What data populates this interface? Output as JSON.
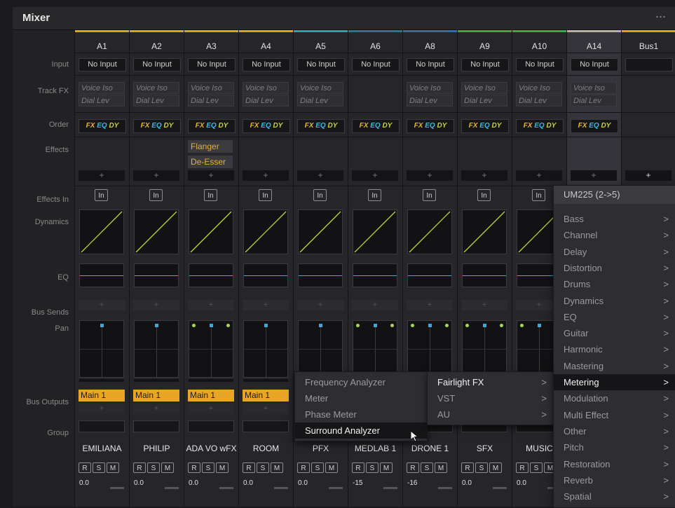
{
  "window": {
    "title": "Mixer"
  },
  "row_labels": {
    "input": "Input",
    "track_fx": "Track FX",
    "order": "Order",
    "effects": "Effects",
    "effects_in": "Effects In",
    "dynamics": "Dynamics",
    "eq": "EQ",
    "bus_sends": "Bus Sends",
    "pan": "Pan",
    "bus_outputs": "Bus Outputs",
    "group": "Group"
  },
  "order_labels": {
    "fx": "FX",
    "eq": "EQ",
    "dy": "DY"
  },
  "common": {
    "plus": "+",
    "in": "In",
    "r": "R",
    "s": "S",
    "m": "M",
    "voice_iso": "Voice Iso",
    "dial_lev": "Dial Lev"
  },
  "strips": [
    {
      "id": "A1",
      "color": "#e0a21f",
      "input": "No Input",
      "fx": true,
      "effects": [],
      "pan": "mono",
      "output": "Main 1",
      "name": "EMILIANA",
      "level": "0.0"
    },
    {
      "id": "A2",
      "color": "#e0a21f",
      "input": "No Input",
      "fx": true,
      "effects": [],
      "pan": "mono",
      "output": "Main 1",
      "name": "PHILIP",
      "level": "0.0"
    },
    {
      "id": "A3",
      "color": "#e0a21f",
      "input": "No Input",
      "fx": true,
      "effects": [
        "Flanger",
        "De-Esser"
      ],
      "pan": "stereo",
      "output": "Main 1",
      "name": "ADA VO wFX",
      "level": "0.0"
    },
    {
      "id": "A4",
      "color": "#e0a21f",
      "input": "No Input",
      "fx": true,
      "effects": [],
      "pan": "mono",
      "output": "Main 1",
      "name": "ROOM",
      "level": "0.0"
    },
    {
      "id": "A5",
      "color": "#2aa6a0",
      "input": "No Input",
      "fx": true,
      "effects": [],
      "pan": "mono",
      "output": "",
      "name": "PFX",
      "level": "0.0"
    },
    {
      "id": "A6",
      "color": "#2f6fa8",
      "input": "No Input",
      "fx": false,
      "effects": [],
      "pan": "stereo",
      "output": "",
      "name": "MEDLAB 1",
      "level": "-15"
    },
    {
      "id": "A8",
      "color": "#2f6fa8",
      "input": "No Input",
      "fx": true,
      "effects": [],
      "pan": "stereo",
      "output": "",
      "name": "DRONE 1",
      "level": "-16"
    },
    {
      "id": "A9",
      "color": "#3aa64a",
      "input": "No Input",
      "fx": true,
      "effects": [],
      "pan": "stereo",
      "output": "",
      "name": "SFX",
      "level": "0.0"
    },
    {
      "id": "A10",
      "color": "#3aa64a",
      "input": "No Input",
      "fx": true,
      "effects": [],
      "pan": "stereo",
      "output": "",
      "name": "MUSIC",
      "level": "0.0"
    },
    {
      "id": "A14",
      "color": "#b8b0a0",
      "input": "No Input",
      "fx": true,
      "effects": [],
      "pan": "mono",
      "output": "",
      "name": "",
      "level": ""
    },
    {
      "id": "Bus1",
      "color": "#e0a21f",
      "input": "",
      "fx": false,
      "effects": [],
      "pan": "none",
      "output": "",
      "name": "",
      "level": ""
    }
  ],
  "submenu1": {
    "items": [
      "Frequency Analyzer",
      "Meter",
      "Phase Meter",
      "Surround Analyzer"
    ],
    "highlighted": 3
  },
  "submenu2": {
    "items": [
      {
        "label": "Fairlight FX",
        "arrow": ">"
      },
      {
        "label": "VST",
        "arrow": ">"
      },
      {
        "label": "AU",
        "arrow": ">"
      }
    ]
  },
  "submenu3": {
    "header": "UM225 (2->5)",
    "items": [
      "Bass",
      "Channel",
      "Delay",
      "Distortion",
      "Drums",
      "Dynamics",
      "EQ",
      "Guitar",
      "Harmonic",
      "Mastering",
      "Metering",
      "Modulation",
      "Multi Effect",
      "Other",
      "Pitch",
      "Restoration",
      "Reverb",
      "Spatial"
    ],
    "highlighted": 10,
    "arrow": ">"
  }
}
